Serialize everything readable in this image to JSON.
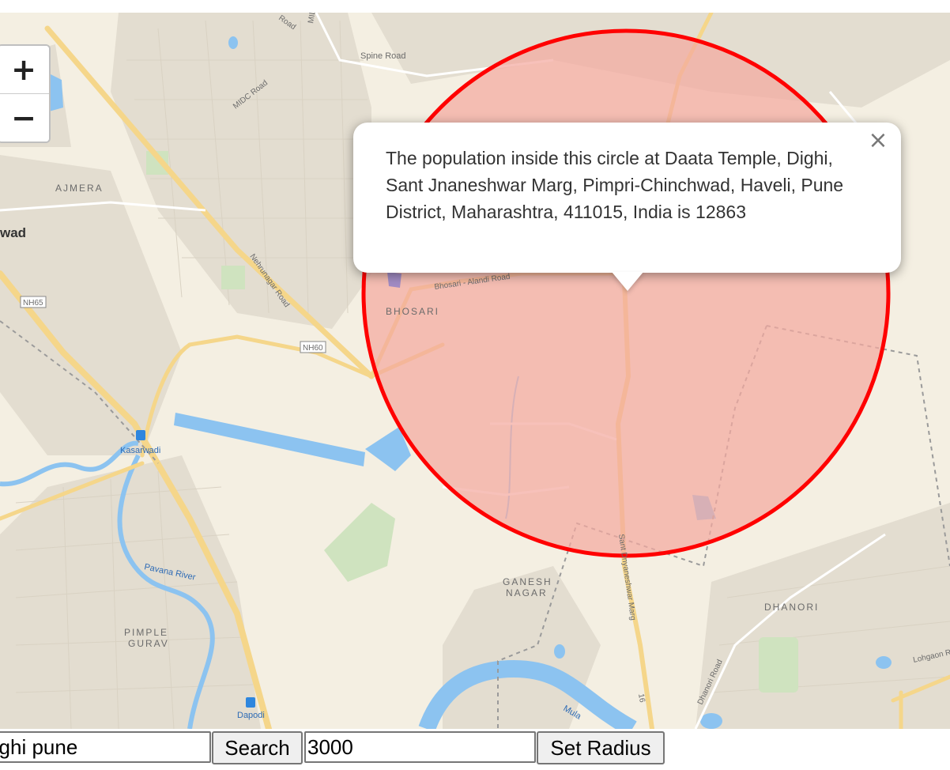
{
  "map": {
    "zoom_in": "+",
    "zoom_out": "−",
    "labels": {
      "road_top": "Road",
      "midc_top": "MIDC",
      "spine_road": "Spine Road",
      "midc_road": "MIDC Road",
      "ajmera": "AJMERA",
      "wad": "wad",
      "nehrunagar_road": "Nehrunagar Road",
      "nh65": "NH65",
      "nh60": "NH60",
      "bhosari_alandi_road": "Bhosari - Alandi Road",
      "bhosari": "BHOSARI",
      "kasarwadi": "Kasarwadi",
      "pavana_river": "Pavana River",
      "pimple_gurav_1": "PIMPLE",
      "pimple_gurav_2": "GURAV",
      "ganesh_nagar_1": "GANESH",
      "ganesh_nagar_2": "NAGAR",
      "sant_dnyaneshwar_marg": "Sant Dnyaneshwar Marg",
      "dhanori": "DHANORI",
      "dhanori_road": "Dhanori Road",
      "lohgaon_road": "Lohgaon Ro",
      "dapodi": "Dapodi",
      "mula": "Mula",
      "route_16": "16"
    },
    "circle": {
      "fill": "#f4a9a0",
      "stroke": "#ff0000"
    }
  },
  "popup": {
    "text": "The population inside this circle at Daata Temple, Dighi, Sant Jnaneshwar Marg, Pimpri-Chinchwad, Haveli, Pune District, Maharashtra, 411015, India is 12863",
    "close": "×"
  },
  "controls": {
    "search_value": "Dighi pune",
    "search_button": "Search",
    "radius_value": "3000",
    "radius_button": "Set Radius"
  }
}
